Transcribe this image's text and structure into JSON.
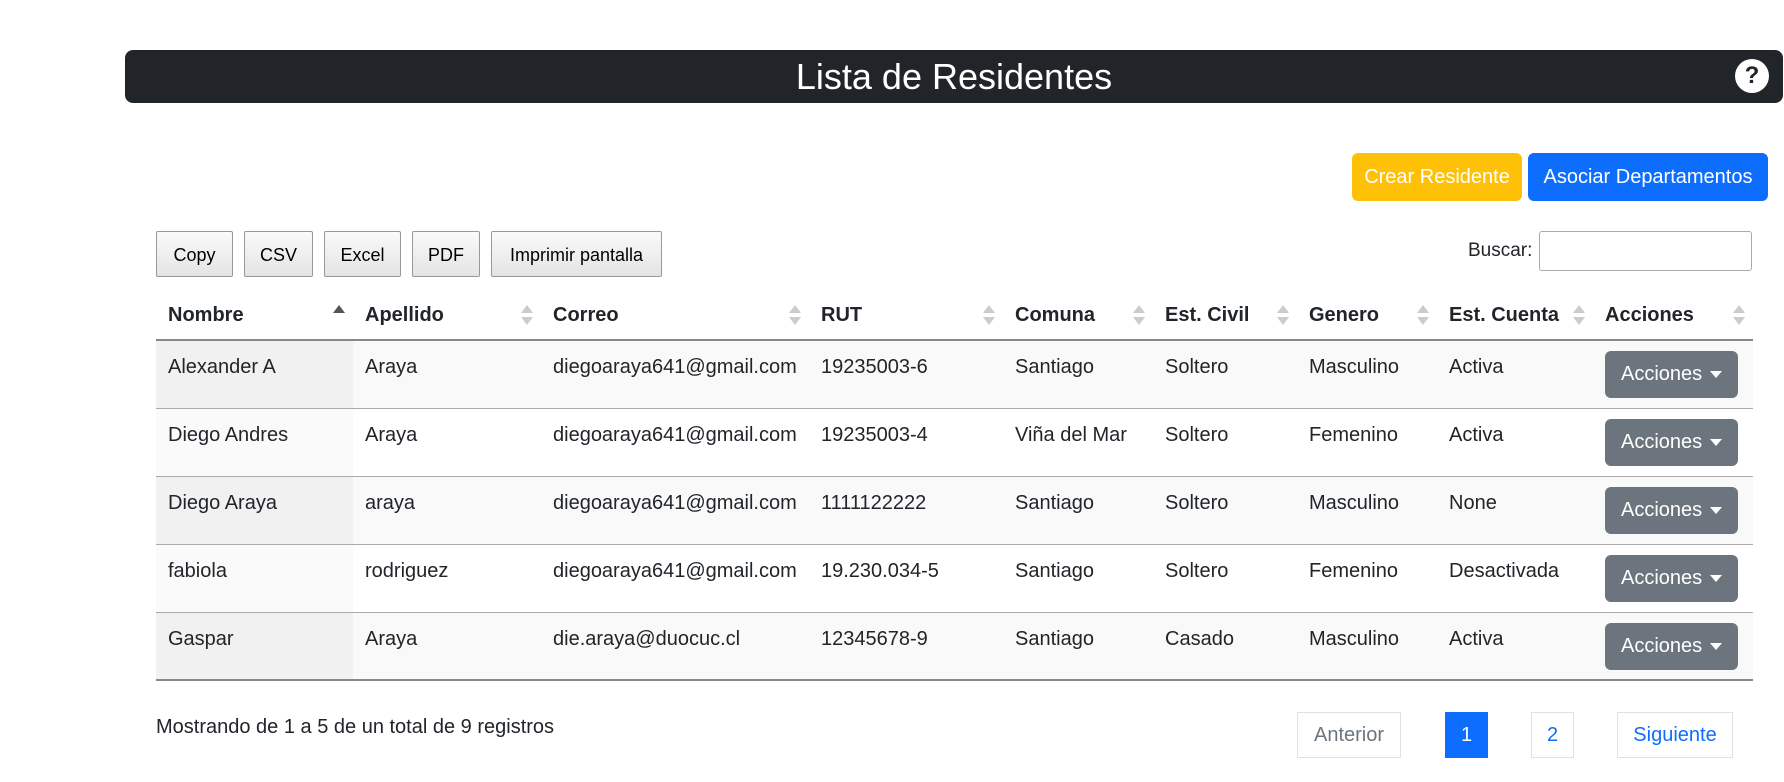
{
  "header": {
    "title": "Lista de Residentes",
    "help_label": "?"
  },
  "actions": {
    "create_label": "Crear Residente",
    "associate_label": "Asociar Departamentos"
  },
  "export_buttons": [
    "Copy",
    "CSV",
    "Excel",
    "PDF",
    "Imprimir pantalla"
  ],
  "search": {
    "label": "Buscar:",
    "value": ""
  },
  "table": {
    "columns": [
      "Nombre",
      "Apellido",
      "Correo",
      "RUT",
      "Comuna",
      "Est. Civil",
      "Genero",
      "Est. Cuenta",
      "Acciones"
    ],
    "sorted_column": "Nombre",
    "sort_direction": "asc",
    "action_label": "Acciones",
    "rows": [
      [
        "Alexander A",
        "Araya",
        "diegoaraya641@gmail.com",
        "19235003-6",
        "Santiago",
        "Soltero",
        "Masculino",
        "Activa"
      ],
      [
        "Diego Andres",
        "Araya",
        "diegoaraya641@gmail.com",
        "19235003-4",
        "Viña del Mar",
        "Soltero",
        "Femenino",
        "Activa"
      ],
      [
        "Diego Araya",
        "araya",
        "diegoaraya641@gmail.com",
        "1111122222",
        "Santiago",
        "Soltero",
        "Masculino",
        "None"
      ],
      [
        "fabiola",
        "rodriguez",
        "diegoaraya641@gmail.com",
        "19.230.034-5",
        "Santiago",
        "Soltero",
        "Femenino",
        "Desactivada"
      ],
      [
        "Gaspar",
        "Araya",
        "die.araya@duocuc.cl",
        "12345678-9",
        "Santiago",
        "Casado",
        "Masculino",
        "Activa"
      ]
    ]
  },
  "footer": {
    "info": "Mostrando de 1 a 5 de un total de 9 registros",
    "pagination": {
      "previous": "Anterior",
      "pages": [
        "1",
        "2"
      ],
      "current": "1",
      "next": "Siguiente"
    }
  },
  "colors": {
    "header_bg": "#212529",
    "create": "#ffc107",
    "associate": "#0d6efd",
    "action": "#6c757d"
  }
}
